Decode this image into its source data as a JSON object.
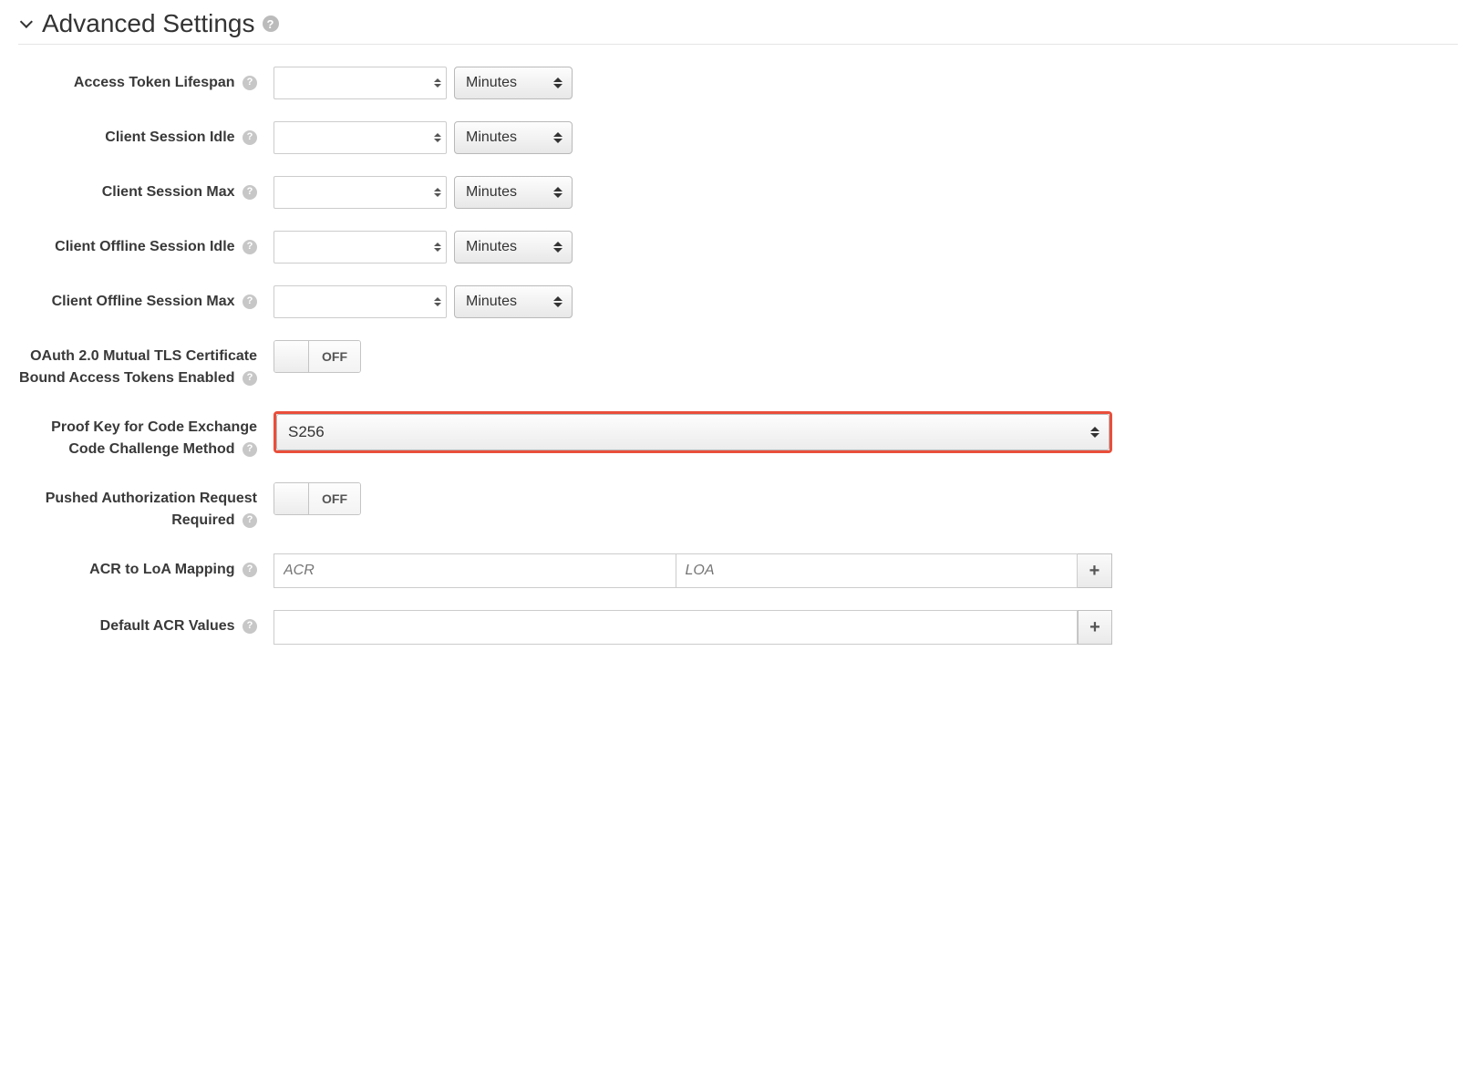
{
  "section": {
    "title": "Advanced Settings"
  },
  "unit_default": "Minutes",
  "fields": {
    "access_token_lifespan": {
      "label": "Access Token Lifespan",
      "value": "",
      "unit": "Minutes"
    },
    "client_session_idle": {
      "label": "Client Session Idle",
      "value": "",
      "unit": "Minutes"
    },
    "client_session_max": {
      "label": "Client Session Max",
      "value": "",
      "unit": "Minutes"
    },
    "client_offline_session_idle": {
      "label": "Client Offline Session Idle",
      "value": "",
      "unit": "Minutes"
    },
    "client_offline_session_max": {
      "label": "Client Offline Session Max",
      "value": "",
      "unit": "Minutes"
    },
    "mtls_tokens_enabled": {
      "label": "OAuth 2.0 Mutual TLS Certificate Bound Access Tokens Enabled",
      "state": "OFF"
    },
    "pkce_method": {
      "label": "Proof Key for Code Exchange Code Challenge Method",
      "value": "S256"
    },
    "par_required": {
      "label": "Pushed Authorization Request Required",
      "state": "OFF"
    },
    "acr_loa_mapping": {
      "label": "ACR to LoA Mapping",
      "acr_placeholder": "ACR",
      "loa_placeholder": "LOA"
    },
    "default_acr_values": {
      "label": "Default ACR Values",
      "value": ""
    }
  },
  "icons": {
    "help": "?",
    "plus": "+"
  }
}
